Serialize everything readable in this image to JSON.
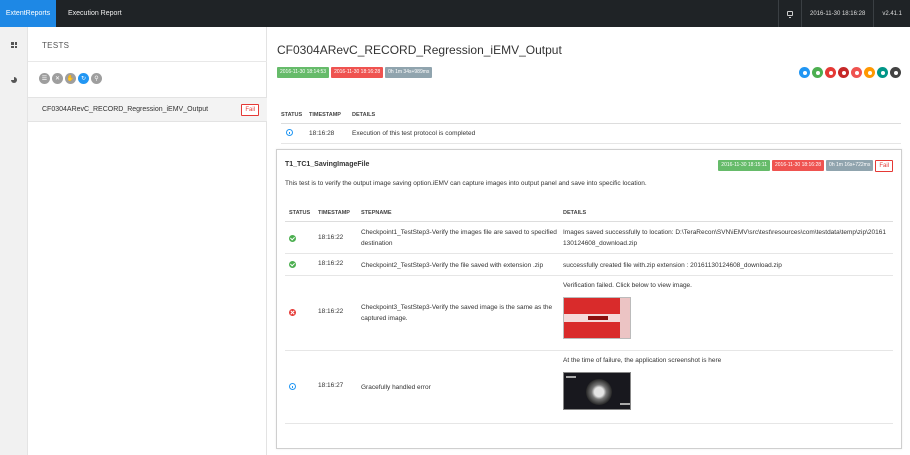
{
  "topbar": {
    "brand": "ExtentReports",
    "title": "Execution Report",
    "datetime": "2016-11-30 18:16:28",
    "version": "v2.41.1"
  },
  "rail": {
    "items": [
      "dashboard-icon",
      "pie-chart-icon"
    ]
  },
  "test_list": {
    "heading": "TESTS",
    "filters": [
      {
        "icon": "list-icon",
        "glyph": "☰"
      },
      {
        "icon": "close-icon",
        "glyph": "✕"
      },
      {
        "icon": "hand-icon",
        "glyph": "✋"
      },
      {
        "icon": "refresh-icon",
        "glyph": "↻"
      },
      {
        "icon": "search-icon",
        "glyph": "⚲"
      }
    ],
    "tests": [
      {
        "name": "CF0304ARevC_RECORD_Regression_iEMV_Output",
        "status": "Fail"
      }
    ]
  },
  "detail": {
    "title": "CF0304ARevC_RECORD_Regression_iEMV_Output",
    "start_time": "2016-11-30 18:14:53",
    "end_time": "2016-11-30 18:16:28",
    "duration": "0h 1m 34s+989ms",
    "status_icons": [
      {
        "icon": "info-icon",
        "color": "#2196f3"
      },
      {
        "icon": "pass-icon",
        "color": "#4caf50"
      },
      {
        "icon": "fail-icon",
        "color": "#e53935"
      },
      {
        "icon": "fatal-icon",
        "color": "#c62828"
      },
      {
        "icon": "error-icon",
        "color": "#ef5350"
      },
      {
        "icon": "warning-icon",
        "color": "#ff9800"
      },
      {
        "icon": "skip-icon",
        "color": "#009688"
      },
      {
        "icon": "unknown-icon",
        "color": "#424242"
      }
    ],
    "log_headers": {
      "status": "STATUS",
      "timestamp": "TIMESTAMP",
      "details": "DETAILS"
    },
    "logs": [
      {
        "status": "info",
        "time": "18:16:28",
        "details": "Execution of this test protocol is completed"
      }
    ],
    "node": {
      "name": "T1_TC1_SavingImageFile",
      "start_time": "2016-11-30 18:15:11",
      "end_time": "2016-11-30 18:16:28",
      "duration": "0h 1m 16s+722ms",
      "status": "Fail",
      "description": "This test is to verify the output image saving option.iEMV can capture images into output panel and save into specific location.",
      "headers": {
        "status": "STATUS",
        "timestamp": "TIMESTAMP",
        "stepname": "STEPNAME",
        "details": "DETAILS"
      },
      "steps": [
        {
          "status": "pass",
          "time": "18:16:22",
          "name": "Checkpoint1_TestStep3-Verify the images file are saved to specified destination",
          "details": "Images saved successfully to location: D:\\TeraRecon\\SVN\\iEMV\\src\\test\\resources\\com\\testdata\\temp\\zip\\20161130124608_download.zip"
        },
        {
          "status": "pass",
          "time": "18:16:22",
          "name": "Checkpoint2_TestStep3-Verify the file saved with extension .zip",
          "details": "successfully created file with.zip extension : 20161130124608_download.zip"
        },
        {
          "status": "fail",
          "time": "18:16:22",
          "name": "Checkpoint3_TestStep3-Verify the saved image is the same as the captured image.",
          "details": "Verification failed. Click below to view image."
        },
        {
          "status": "info",
          "time": "18:16:27",
          "name": "Gracefully handled error",
          "details": "At the time of failure, the application screenshot is here"
        }
      ]
    }
  }
}
